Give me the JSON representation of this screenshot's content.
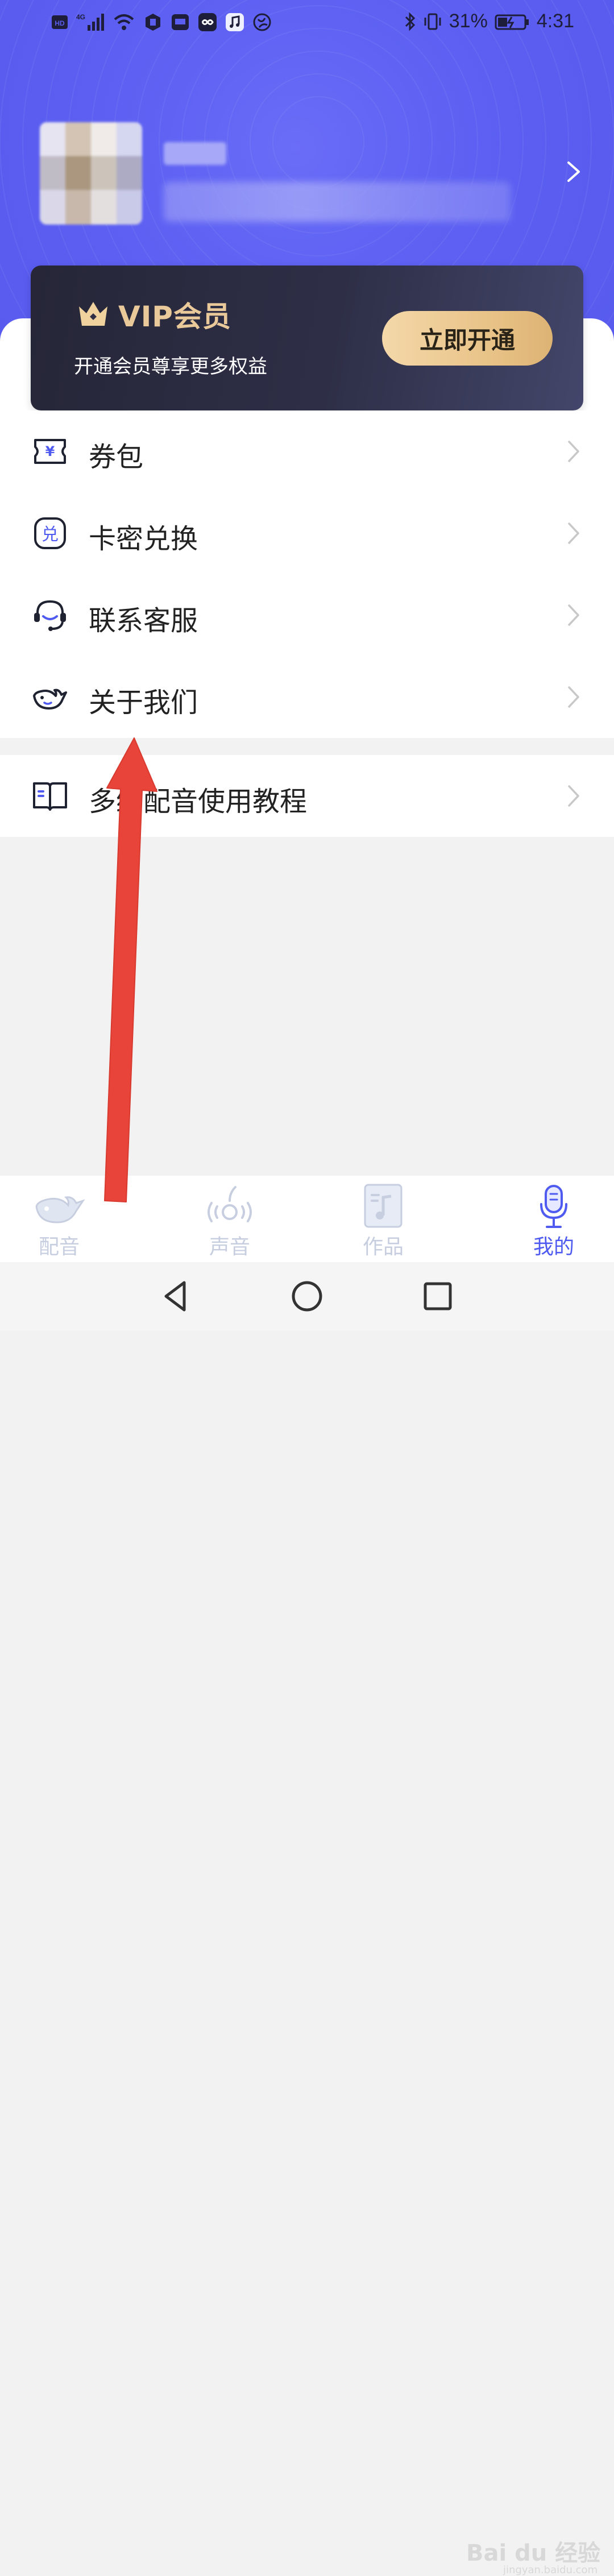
{
  "status_bar": {
    "battery_percent": "31%",
    "time": "4:31",
    "left_icons": [
      "hd-icon",
      "4g-signal-icon",
      "wifi-icon",
      "notification-icon",
      "huawei-icon",
      "infinity-app-icon",
      "music-app-icon",
      "browser-icon"
    ],
    "right_icons": [
      "bluetooth-icon",
      "vibrate-icon",
      "battery-icon"
    ]
  },
  "profile": {
    "avatar": "blurred-avatar",
    "name": "",
    "id": ""
  },
  "vip": {
    "title": "VIP会员",
    "subtitle": "开通会员尊享更多权益",
    "button_label": "立即开通",
    "accent_color": "#e9c89a"
  },
  "menu": {
    "items": [
      {
        "label": "券包",
        "icon": "coupon-icon"
      },
      {
        "label": "卡密兑换",
        "icon": "redeem-icon"
      },
      {
        "label": "联系客服",
        "icon": "headset-icon"
      },
      {
        "label": "关于我们",
        "icon": "whale-icon"
      }
    ],
    "tutorial": {
      "label": "多给配音使用教程",
      "icon": "book-icon"
    }
  },
  "tabs": [
    {
      "label": "配音",
      "icon": "whale-icon",
      "active": false
    },
    {
      "label": "声音",
      "icon": "sound-icon",
      "active": false
    },
    {
      "label": "作品",
      "icon": "music-file-icon",
      "active": false
    },
    {
      "label": "我的",
      "icon": "microphone-icon",
      "active": true
    }
  ],
  "system_nav": [
    "back-icon",
    "home-icon",
    "recents-icon"
  ],
  "watermark": {
    "main": "Bai du 经验",
    "sub": "jingyan.baidu.com"
  },
  "colors": {
    "header": "#5a5df0",
    "active_tab": "#4f5bf0",
    "inactive_tab": "#c7cee0",
    "annotation_arrow": "#e8443a"
  }
}
